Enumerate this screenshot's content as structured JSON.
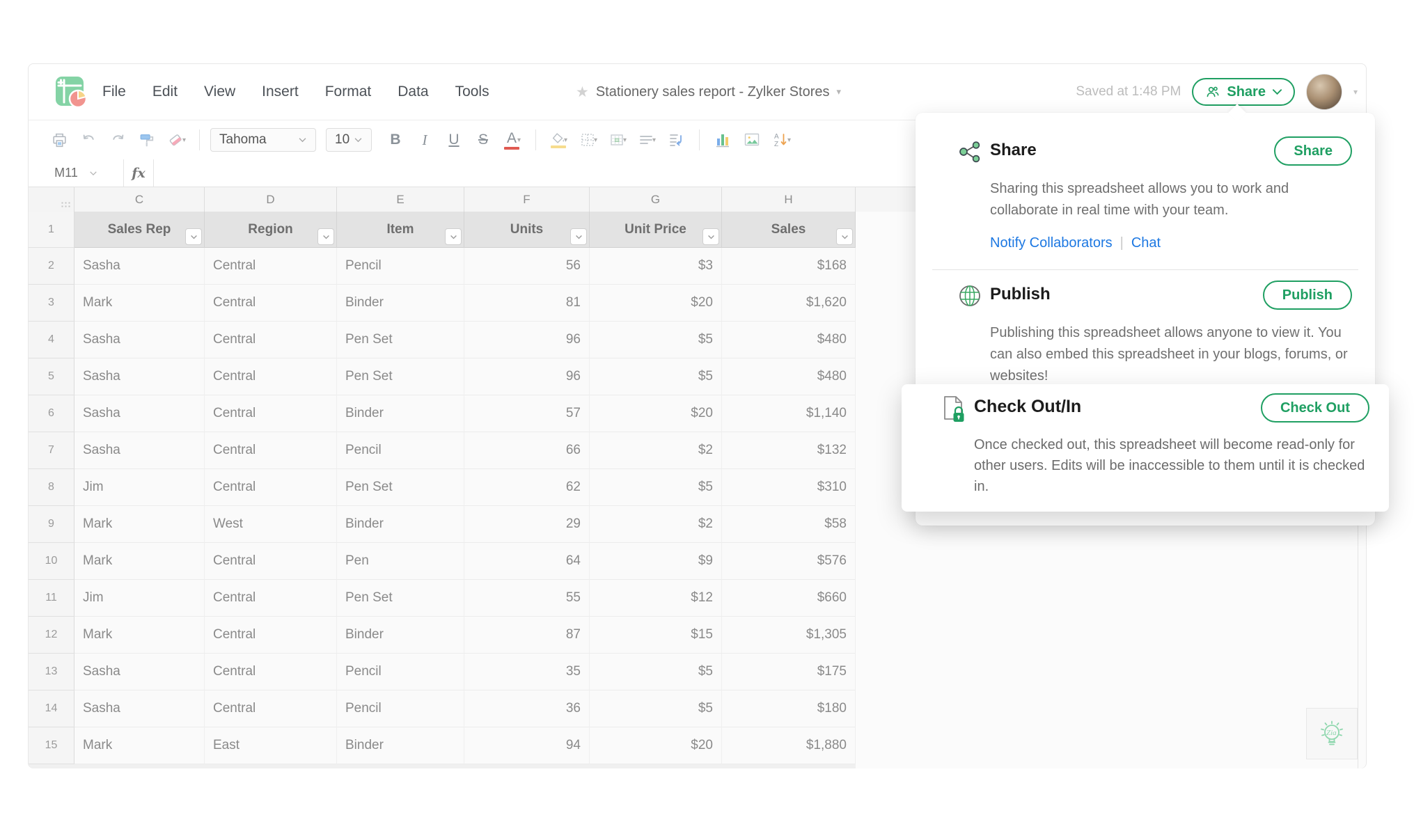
{
  "colors": {
    "accent_green": "#1f9f62",
    "link_blue": "#1d78e2"
  },
  "header": {
    "title": "Stationery sales report - Zylker Stores",
    "saved_status": "Saved at 1:48 PM",
    "share_label": "Share"
  },
  "menu": {
    "items": [
      "File",
      "Edit",
      "View",
      "Insert",
      "Format",
      "Data",
      "Tools"
    ]
  },
  "toolbar": {
    "font_name": "Tahoma",
    "font_size": "10",
    "bold": "B",
    "italic": "I",
    "underline": "U",
    "strikethrough": "S",
    "font_color_letter": "A"
  },
  "formula_bar": {
    "cell_ref": "M11",
    "fx_label": "fx",
    "formula": ""
  },
  "sheet": {
    "column_letters": [
      "C",
      "D",
      "E",
      "F",
      "G",
      "H"
    ],
    "header_row": [
      "Sales Rep",
      "Region",
      "Item",
      "Units",
      "Unit Price",
      "Sales"
    ],
    "rows": [
      {
        "num": "2",
        "cells": [
          "Sasha",
          "Central",
          "Pencil",
          "56",
          "$3",
          "$168"
        ]
      },
      {
        "num": "3",
        "cells": [
          "Mark",
          "Central",
          "Binder",
          "81",
          "$20",
          "$1,620"
        ]
      },
      {
        "num": "4",
        "cells": [
          "Sasha",
          "Central",
          "Pen Set",
          "96",
          "$5",
          "$480"
        ]
      },
      {
        "num": "5",
        "cells": [
          "Sasha",
          "Central",
          "Pen Set",
          "96",
          "$5",
          "$480"
        ]
      },
      {
        "num": "6",
        "cells": [
          "Sasha",
          "Central",
          "Binder",
          "57",
          "$20",
          "$1,140"
        ]
      },
      {
        "num": "7",
        "cells": [
          "Sasha",
          "Central",
          "Pencil",
          "66",
          "$2",
          "$132"
        ]
      },
      {
        "num": "8",
        "cells": [
          "Jim",
          "Central",
          "Pen Set",
          "62",
          "$5",
          "$310"
        ]
      },
      {
        "num": "9",
        "cells": [
          "Mark",
          "West",
          "Binder",
          "29",
          "$2",
          "$58"
        ]
      },
      {
        "num": "10",
        "cells": [
          "Mark",
          "Central",
          "Pen",
          "64",
          "$9",
          "$576"
        ]
      },
      {
        "num": "11",
        "cells": [
          "Jim",
          "Central",
          "Pen Set",
          "55",
          "$12",
          "$660"
        ]
      },
      {
        "num": "12",
        "cells": [
          "Mark",
          "Central",
          "Binder",
          "87",
          "$15",
          "$1,305"
        ]
      },
      {
        "num": "13",
        "cells": [
          "Sasha",
          "Central",
          "Pencil",
          "35",
          "$5",
          "$175"
        ]
      },
      {
        "num": "14",
        "cells": [
          "Sasha",
          "Central",
          "Pencil",
          "36",
          "$5",
          "$180"
        ]
      },
      {
        "num": "15",
        "cells": [
          "Mark",
          "East",
          "Binder",
          "94",
          "$20",
          "$1,880"
        ]
      }
    ]
  },
  "popup": {
    "share": {
      "title": "Share",
      "button": "Share",
      "description": "Sharing this spreadsheet allows you to work and collaborate in real time with your team.",
      "link_notify": "Notify Collaborators",
      "link_chat": "Chat"
    },
    "publish": {
      "title": "Publish",
      "button": "Publish",
      "description": "Publishing this spreadsheet allows anyone to view it. You can also embed this spreadsheet in your blogs, forums, or websites!"
    },
    "checkout": {
      "title": "Check Out/In",
      "button": "Check Out",
      "description": "Once checked out, this spreadsheet will become read-only for other users. Edits will be inaccessible to them until it is checked in."
    }
  },
  "zia": {
    "label": "Zia"
  }
}
